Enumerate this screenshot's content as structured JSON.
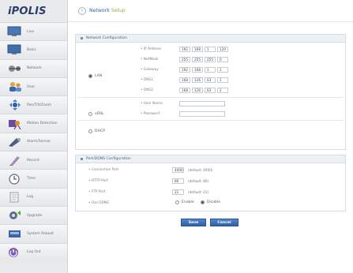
{
  "brand": {
    "logo_text": "iPOLIS"
  },
  "sidebar": {
    "items": [
      {
        "label": "Live",
        "icon": "monitor-icon"
      },
      {
        "label": "Basic",
        "icon": "monitor-icon"
      },
      {
        "label": "Network",
        "icon": "network-icon"
      },
      {
        "label": "User",
        "icon": "users-icon"
      },
      {
        "label": "Pan/Tilt/Zoom",
        "icon": "ptz-icon"
      },
      {
        "label": "Motion Detection",
        "icon": "motion-icon"
      },
      {
        "label": "Alarm/Sensor",
        "icon": "alarm-icon"
      },
      {
        "label": "Record",
        "icon": "record-icon"
      },
      {
        "label": "Time",
        "icon": "clock-icon"
      },
      {
        "label": "Log",
        "icon": "log-icon"
      },
      {
        "label": "Upgrade",
        "icon": "upgrade-icon"
      },
      {
        "label": "System Reboot",
        "icon": "reboot-icon"
      },
      {
        "label": "Log Out",
        "icon": "logout-icon"
      }
    ]
  },
  "header": {
    "title_main": "Network",
    "title_accent": "Setup"
  },
  "network_config": {
    "title": "Network Configuration",
    "lan_label": "LAN",
    "xdsl_label": "xDSL",
    "dhcp_label": "DHCP",
    "selected_mode": "LAN",
    "fields": {
      "ip_label": "• IP Address",
      "netmask_label": "• NetMask",
      "gateway_label": "• Gateway",
      "dns1_label": "• DNS1",
      "dns2_label": "• DNS2",
      "username_label": "• User Name",
      "password_label": "• Password"
    },
    "ip": [
      "192",
      "168",
      "1",
      "120"
    ],
    "netmask": [
      "255",
      "255",
      "255",
      "0"
    ],
    "gateway": [
      "192",
      "168",
      "1",
      "1"
    ],
    "dns1": [
      "168",
      "126",
      "63",
      "1"
    ],
    "dns2": [
      "168",
      "126",
      "63",
      "2"
    ]
  },
  "port_config": {
    "title": "Port/DDNS Configuration",
    "connection_port_label": "• Connection Port",
    "connection_port_value": "4000",
    "connection_port_default": "(default: 4000)",
    "http_port_label": "• HTTP Port",
    "http_port_value": "80",
    "http_port_default": "(default: 80)",
    "ftp_port_label": "• FTP Port",
    "ftp_port_value": "21",
    "ftp_port_default": "(default: 21)",
    "ddns_label": "• Use DDNS",
    "enable_label": "Enable",
    "disable_label": "Disable",
    "ddns_selected": "Disable"
  },
  "actions": {
    "save_label": "Save",
    "cancel_label": "Cancel"
  },
  "colors": {
    "brand": "#2c3e67",
    "title_blue": "#2d5fa3",
    "title_accent": "#8fb23a",
    "button": "#2f61a5"
  }
}
